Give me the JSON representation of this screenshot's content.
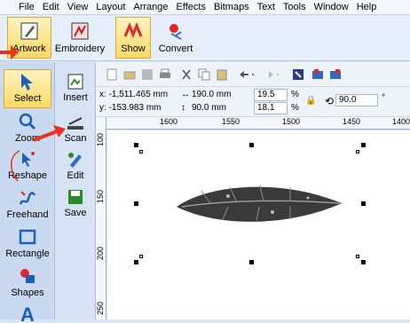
{
  "menu": [
    "File",
    "Edit",
    "View",
    "Layout",
    "Arrange",
    "Effects",
    "Bitmaps",
    "Text",
    "Tools",
    "Window",
    "Help"
  ],
  "modes": [
    {
      "label": "Artwork",
      "active": true
    },
    {
      "label": "Embroidery",
      "active": false
    },
    {
      "label": "Show",
      "active": true
    },
    {
      "label": "Convert",
      "active": false
    }
  ],
  "left_tools": [
    {
      "label": "Select"
    },
    {
      "label": "Zoom"
    },
    {
      "label": "Reshape"
    },
    {
      "label": "Freehand"
    },
    {
      "label": "Rectangle"
    },
    {
      "label": "Shapes"
    }
  ],
  "side_tools": [
    {
      "label": "Insert"
    },
    {
      "label": "Scan"
    },
    {
      "label": "Edit"
    },
    {
      "label": "Save"
    }
  ],
  "properties": {
    "x": "x: -1,511.465 mm",
    "y": "y: -153.983 mm",
    "width": "190.0 mm",
    "height": "90.0 mm",
    "scale_x": "19.5",
    "scale_y": "18.1",
    "percent": "%",
    "rotation": "90.0",
    "degree": "°"
  },
  "hruler_labels": [
    "1600",
    "1550",
    "1500",
    "1450",
    "1400"
  ],
  "vruler_labels": [
    "100",
    "150",
    "200",
    "250"
  ],
  "colors": {
    "active_bg": "#ffd965",
    "arrow": "#e8341c"
  }
}
